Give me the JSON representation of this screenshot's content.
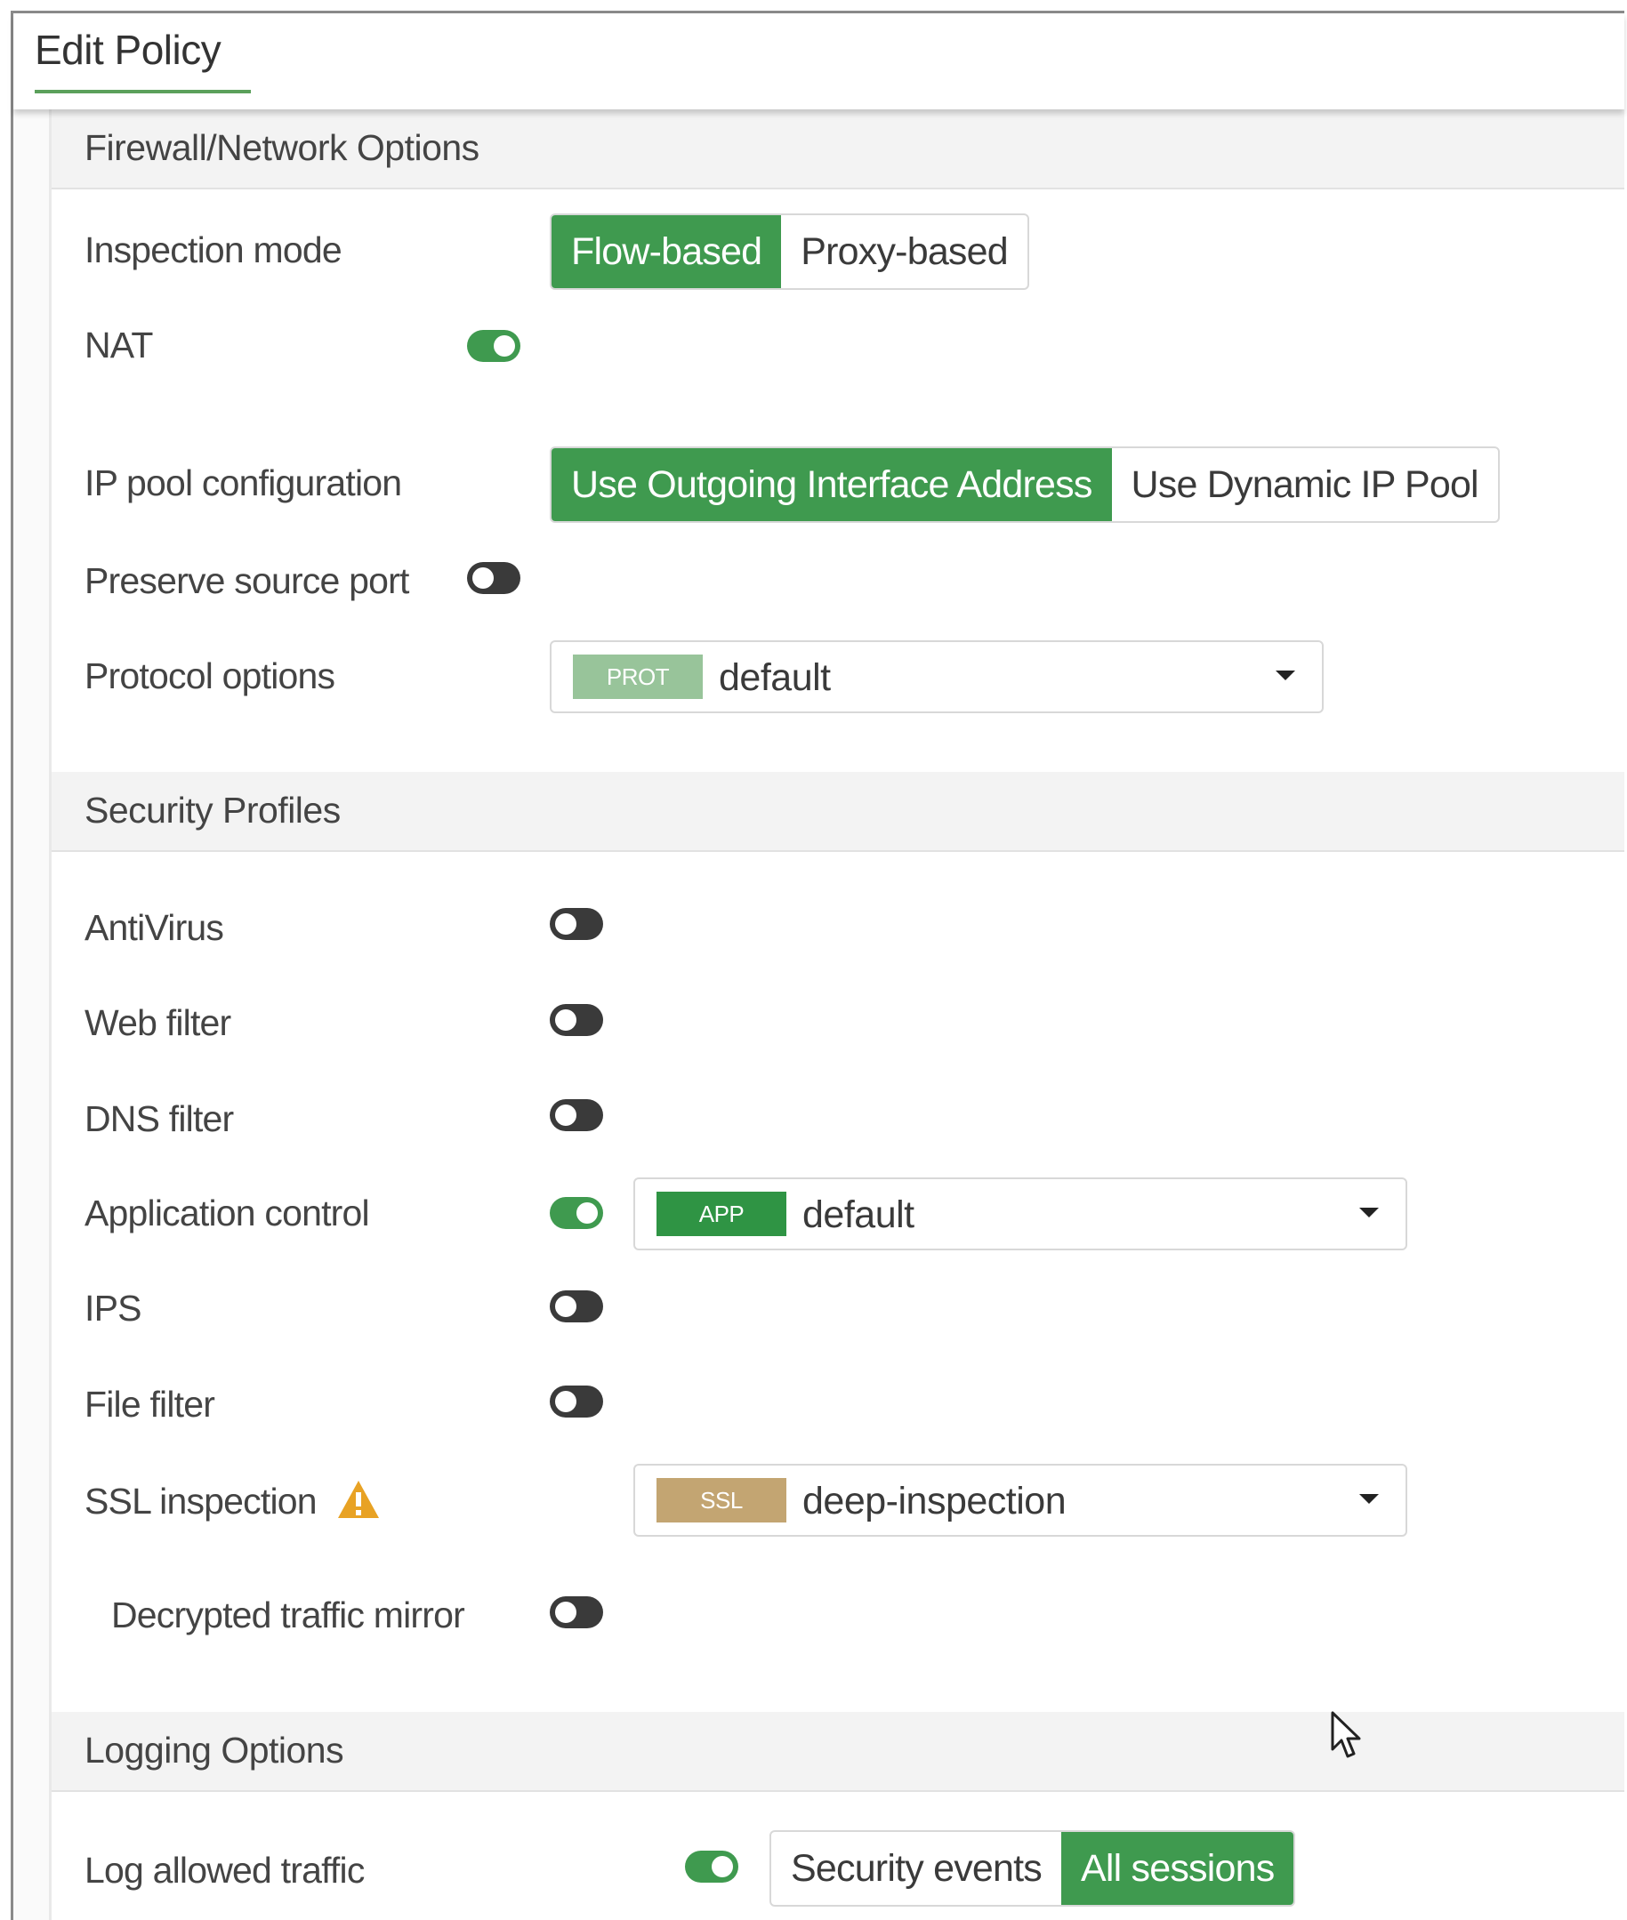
{
  "window": {
    "title": "Edit Policy"
  },
  "sections": {
    "firewall": "Firewall/Network Options",
    "security": "Security Profiles",
    "logging": "Logging Options"
  },
  "inspection_mode": {
    "label": "Inspection mode",
    "options": [
      "Flow-based",
      "Proxy-based"
    ],
    "selected": "Flow-based"
  },
  "nat": {
    "label": "NAT",
    "enabled": true
  },
  "ip_pool": {
    "label": "IP pool configuration",
    "options": [
      "Use Outgoing Interface Address",
      "Use Dynamic IP Pool"
    ],
    "selected": "Use Outgoing Interface Address"
  },
  "preserve_source_port": {
    "label": "Preserve source port",
    "enabled": false
  },
  "protocol_options": {
    "label": "Protocol options",
    "badge": "PROT",
    "value": "default",
    "badge_color": "#98c49a"
  },
  "antivirus": {
    "label": "AntiVirus",
    "enabled": false
  },
  "web_filter": {
    "label": "Web filter",
    "enabled": false
  },
  "dns_filter": {
    "label": "DNS filter",
    "enabled": false
  },
  "application_control": {
    "label": "Application control",
    "enabled": true,
    "badge": "APP",
    "value": "default",
    "badge_color": "#2f9444"
  },
  "ips": {
    "label": "IPS",
    "enabled": false
  },
  "file_filter": {
    "label": "File filter",
    "enabled": false
  },
  "ssl_inspection": {
    "label": "SSL inspection",
    "badge": "SSL",
    "value": "deep-inspection",
    "badge_color": "#c3a572",
    "icon": "warning-icon"
  },
  "decrypted_traffic_mirror": {
    "label": "Decrypted traffic mirror",
    "enabled": false
  },
  "log_allowed_traffic": {
    "label": "Log allowed traffic",
    "enabled": true,
    "options": [
      "Security events",
      "All sessions"
    ],
    "selected": "All sessions"
  },
  "colors": {
    "accent": "#3f9a4f",
    "toggle_off": "#3a3a3a",
    "warning": "#e8a224"
  }
}
